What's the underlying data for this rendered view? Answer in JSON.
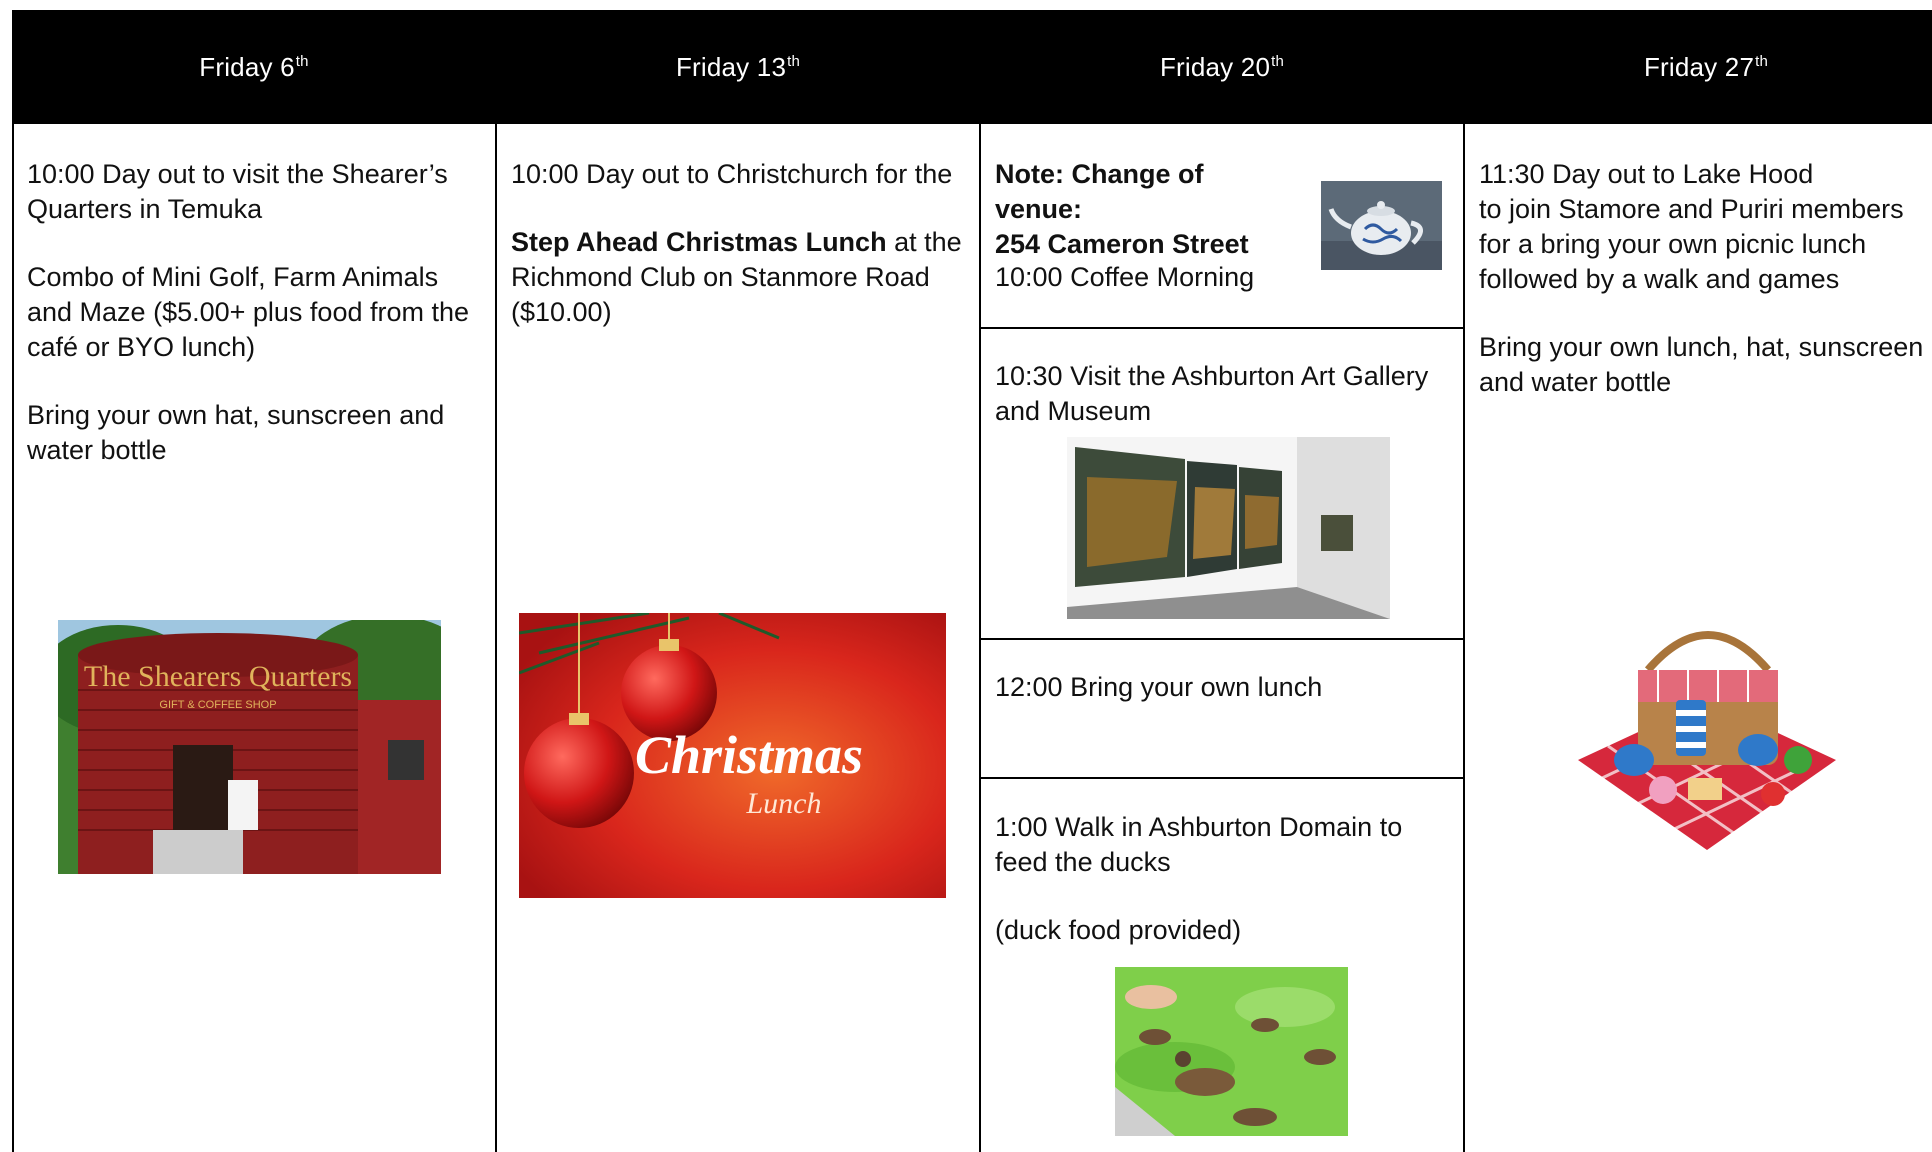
{
  "columns": [
    {
      "header": {
        "day": "Friday 6",
        "suffix": "th"
      },
      "paragraphs": [
        "10:00 Day out to visit the Shearer’s Quarters in Temuka",
        "Combo of Mini Golf, Farm Animals and Maze ($5.00+ plus food from the café or BYO lunch)",
        "Bring your own hat, sunscreen and water bottle"
      ],
      "image_sign": {
        "line1": "The Shearers Quarters",
        "line2": "GIFT & COFFEE SHOP"
      }
    },
    {
      "header": {
        "day": "Friday 13",
        "suffix": "th"
      },
      "p1": "10:00 Day out to Christchurch for the",
      "p2_bold": "Step Ahead Christmas Lunch",
      "p2_rest": " at the Richmond Club on Stanmore Road ($10.00)",
      "image_text": {
        "line1": "Christmas",
        "line2": "Lunch"
      }
    },
    {
      "header": {
        "day": "Friday 20",
        "suffix": "th"
      },
      "note_line1": "Note: Change of venue:",
      "note_line2": "254 Cameron Street",
      "coffee": "10:00 Coffee Morning",
      "gallery": "10:30 Visit the Ashburton Art Gallery and Museum",
      "lunch": "12:00 Bring your own lunch",
      "walk": "1:00 Walk in Ashburton Domain to feed the ducks",
      "duck_food": "(duck food provided)"
    },
    {
      "header": {
        "day": "Friday 27",
        "suffix": "th"
      },
      "p1_line1": "11:30 Day out to Lake Hood",
      "p1_rest": "to join Stamore and Puriri members for a bring your own picnic lunch followed by a walk and games",
      "p2": "Bring your own lunch, hat, sunscreen and water bottle"
    }
  ],
  "colors": {
    "header_bg": "#000000",
    "header_text": "#ffffff",
    "barn_red": "#8e1f1f",
    "christmas_red": "#d9261c",
    "picnic_red": "#d6283c",
    "duck_water": "#7fcf4a"
  }
}
